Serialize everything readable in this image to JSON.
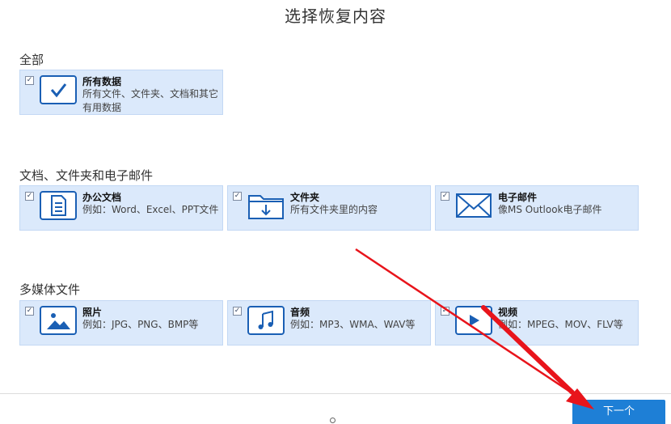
{
  "title": "选择恢复内容",
  "sections": [
    {
      "label": "全部",
      "items": [
        {
          "title": "所有数据",
          "desc": "所有文件、文件夹、文档和其它有用数据",
          "icon": "check-icon",
          "checked": true
        }
      ]
    },
    {
      "label": "文档、文件夹和电子邮件",
      "items": [
        {
          "title": "办公文档",
          "desc": "例如：Word、Excel、PPT文件",
          "icon": "document-icon",
          "checked": true
        },
        {
          "title": "文件夹",
          "desc": "所有文件夹里的内容",
          "icon": "folder-icon",
          "checked": true
        },
        {
          "title": "电子邮件",
          "desc": "像MS Outlook电子邮件",
          "icon": "email-icon",
          "checked": true
        }
      ]
    },
    {
      "label": "多媒体文件",
      "items": [
        {
          "title": "照片",
          "desc": "例如：JPG、PNG、BMP等",
          "icon": "photo-icon",
          "checked": true
        },
        {
          "title": "音频",
          "desc": "例如：MP3、WMA、WAV等",
          "icon": "music-icon",
          "checked": true
        },
        {
          "title": "视频",
          "desc": "例如：MPEG、MOV、FLV等",
          "icon": "video-icon",
          "checked": true
        }
      ]
    }
  ],
  "footer": {
    "next_label": "下一个"
  },
  "colors": {
    "card_bg": "#dbe9fb",
    "icon_blue": "#1a5fb4",
    "button_blue": "#1e7fd6",
    "arrow_red": "#e8141b"
  }
}
